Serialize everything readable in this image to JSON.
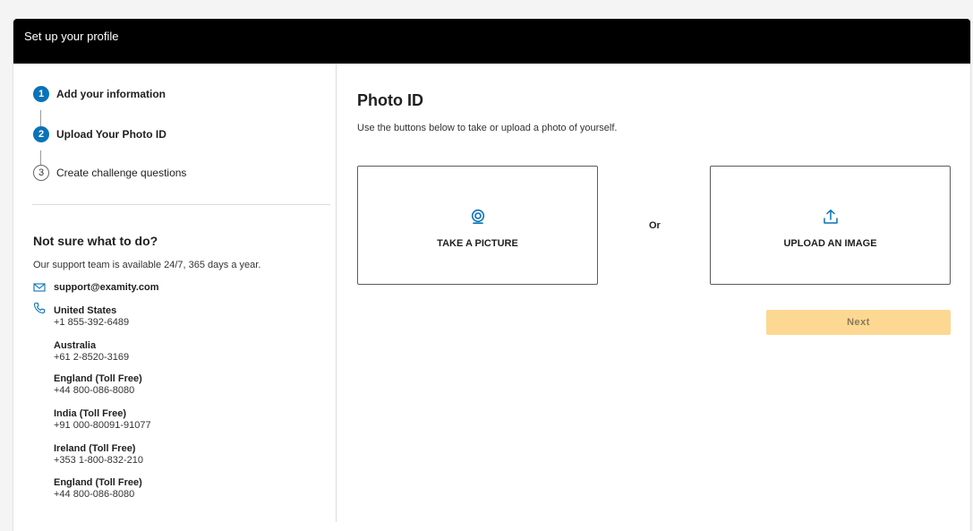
{
  "header": {
    "title": "Set up your profile"
  },
  "steps": [
    {
      "number": "1",
      "label": "Add your information",
      "state": "active"
    },
    {
      "number": "2",
      "label": "Upload Your Photo ID",
      "state": "active"
    },
    {
      "number": "3",
      "label": "Create challenge questions",
      "state": "todo"
    }
  ],
  "help": {
    "title": "Not sure what to do?",
    "subtitle": "Our support team is available 24/7, 365 days a year.",
    "email": "support@examity.com",
    "email_icon": "mail-icon",
    "phone_icon": "phone-icon",
    "contacts": [
      {
        "country": "United States",
        "phone": "+1 855-392-6489"
      },
      {
        "country": "Australia",
        "phone": "+61 2-8520-3169"
      },
      {
        "country": "England (Toll Free)",
        "phone": "+44 800-086-8080"
      },
      {
        "country": "India (Toll Free)",
        "phone": "+91 000-80091-91077"
      },
      {
        "country": "Ireland (Toll Free)",
        "phone": "+353 1-800-832-210"
      },
      {
        "country": "England (Toll Free)",
        "phone": "+44 800-086-8080"
      }
    ]
  },
  "main": {
    "title": "Photo ID",
    "subtitle": "Use the buttons below to take or upload a photo of yourself.",
    "take_picture": {
      "label": "TAKE A PICTURE",
      "icon": "webcam-icon"
    },
    "or_label": "Or",
    "upload_image": {
      "label": "UPLOAD AN IMAGE",
      "icon": "upload-icon"
    },
    "next_label": "Next"
  },
  "colors": {
    "accent": "#0a73b7",
    "header_bg": "#000000",
    "next_disabled": "#fdd893"
  }
}
